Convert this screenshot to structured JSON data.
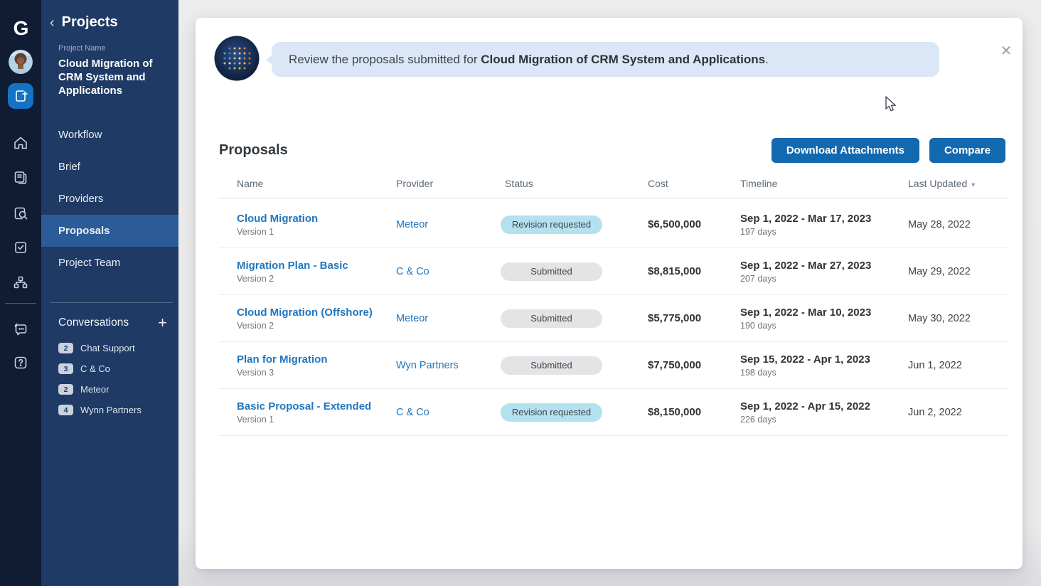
{
  "colors": {
    "rail_bg": "#0f1c33",
    "sidebar_bg": "#1f3a64",
    "sidebar_active_bg": "#2b5c98",
    "accent_button": "#1269b0",
    "link_blue": "#2176bd",
    "bubble_bg": "#dbe7f7",
    "pill_revision": "#b3e1ef",
    "pill_submitted": "#e4e4e6"
  },
  "rail": {
    "logo_text": "G",
    "icons": [
      "add-project",
      "home",
      "documents",
      "search-document",
      "tasks-check",
      "org-chart",
      "chat",
      "help"
    ]
  },
  "sidebar": {
    "back_icon": "‹",
    "header": "Projects",
    "project_label": "Project Name",
    "project_title": "Cloud Migration of CRM System and Applications",
    "nav": [
      {
        "label": "Workflow"
      },
      {
        "label": "Brief"
      },
      {
        "label": "Providers"
      },
      {
        "label": "Proposals",
        "active": true
      },
      {
        "label": "Project Team"
      }
    ],
    "conversations": {
      "title": "Conversations",
      "add_icon": "+",
      "items": [
        {
          "count": "2",
          "name": "Chat Support"
        },
        {
          "count": "3",
          "name": "C & Co"
        },
        {
          "count": "2",
          "name": "Meteor"
        },
        {
          "count": "4",
          "name": "Wynn Partners"
        }
      ]
    }
  },
  "modal": {
    "close_icon": "✕",
    "assistant_message": {
      "prefix": "Review the proposals submitted for ",
      "bold": "Cloud Migration of CRM System and Applications",
      "suffix": "."
    },
    "title": "Proposals",
    "buttons": {
      "download": "Download Attachments",
      "compare": "Compare"
    }
  },
  "table": {
    "columns": {
      "name": "Name",
      "provider": "Provider",
      "status": "Status",
      "cost": "Cost",
      "timeline": "Timeline",
      "last_updated": "Last Updated",
      "sort_icon": "▾"
    },
    "rows": [
      {
        "name": "Cloud Migration",
        "version": "Version 1",
        "provider": "Meteor",
        "status": "Revision requested",
        "cost": "$6,500,000",
        "timeline": "Sep 1, 2022 - Mar 17, 2023",
        "days": "197 days",
        "updated": "May 28, 2022"
      },
      {
        "name": "Migration Plan  - Basic",
        "version": "Version 2",
        "provider": "C & Co",
        "status": "Submitted",
        "cost": "$8,815,000",
        "timeline": "Sep 1, 2022 - Mar 27, 2023",
        "days": "207 days",
        "updated": "May 29, 2022"
      },
      {
        "name": "Cloud Migration (Offshore)",
        "version": "Version 2",
        "provider": "Meteor",
        "status": "Submitted",
        "cost": "$5,775,000",
        "timeline": "Sep 1, 2022 - Mar 10, 2023",
        "days": "190 days",
        "updated": "May 30, 2022"
      },
      {
        "name": "Plan for Migration",
        "version": "Version 3",
        "provider": "Wyn Partners",
        "status": "Submitted",
        "cost": "$7,750,000",
        "timeline": "Sep 15, 2022 - Apr 1, 2023",
        "days": "198 days",
        "updated": "Jun 1, 2022"
      },
      {
        "name": "Basic Proposal - Extended",
        "version": "Version 1",
        "provider": "C & Co",
        "status": "Revision requested",
        "cost": "$8,150,000",
        "timeline": "Sep 1, 2022 - Apr 15, 2022",
        "days": "226 days",
        "updated": "Jun 2, 2022"
      }
    ]
  }
}
